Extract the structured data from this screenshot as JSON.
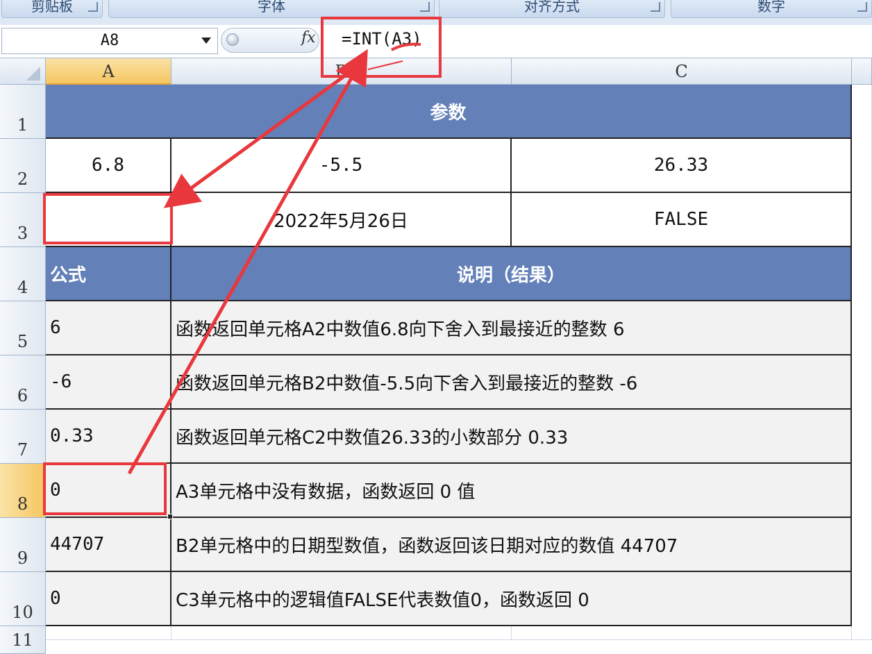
{
  "ribbon": {
    "groups": [
      "剪贴板",
      "字体",
      "对齐方式",
      "数字"
    ]
  },
  "formula_bar": {
    "name_box": "A8",
    "fx_label": "fx",
    "formula": "=INT(A3)"
  },
  "columns": [
    "A",
    "B",
    "C"
  ],
  "selected_column": "A",
  "rows": [
    "1",
    "2",
    "3",
    "4",
    "5",
    "6",
    "7",
    "8",
    "9",
    "10",
    "11"
  ],
  "selected_row": "8",
  "sheet": {
    "params_header": "参数",
    "row2": {
      "a": "6.8",
      "b": "-5.5",
      "c": "26.33"
    },
    "row3": {
      "a": "",
      "b": "2022年5月26日",
      "c": "FALSE"
    },
    "formula_header": "公式",
    "desc_header": "说明（结果）",
    "data_rows": [
      {
        "formula": "6",
        "desc": "函数返回单元格A2中数值6.8向下舍入到最接近的整数 6"
      },
      {
        "formula": "-6",
        "desc": "函数返回单元格B2中数值-5.5向下舍入到最接近的整数 -6"
      },
      {
        "formula": "0.33",
        "desc": "函数返回单元格C2中数值26.33的小数部分 0.33"
      },
      {
        "formula": "0",
        "desc": "A3单元格中没有数据，函数返回 0 值"
      },
      {
        "formula": "44707",
        "desc": "B2单元格中的日期型数值，函数返回该日期对应的数值 44707"
      },
      {
        "formula": "0",
        "desc": "C3单元格中的逻辑值FALSE代表数值0，函数返回 0"
      }
    ]
  },
  "annotation_color": "#e8383d",
  "header_fill": "#6380b8"
}
